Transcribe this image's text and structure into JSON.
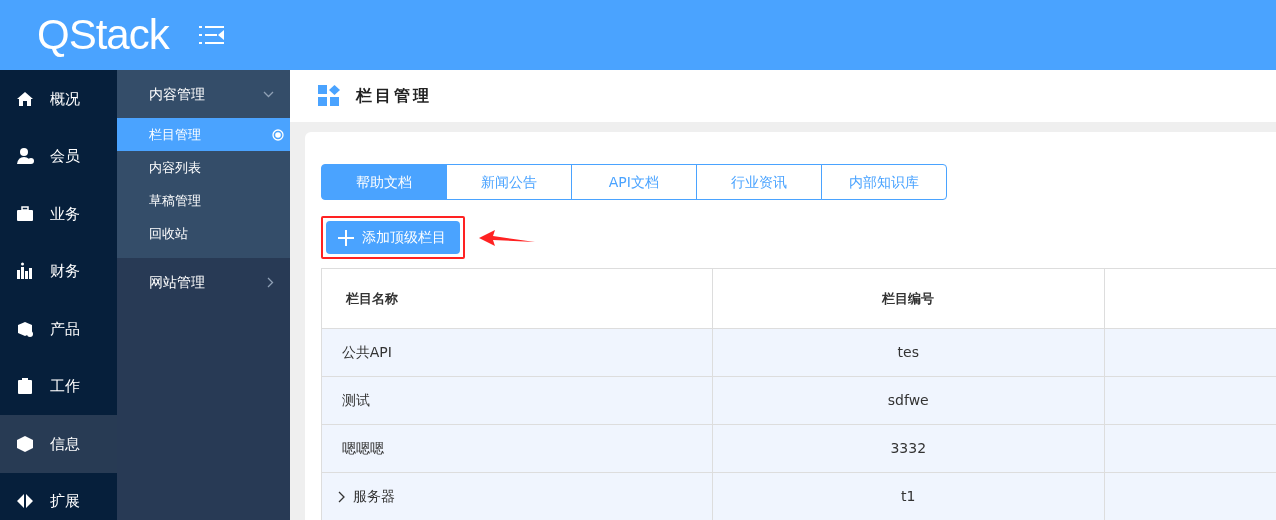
{
  "header": {
    "logo": "QStack"
  },
  "nav": [
    {
      "label": "概况",
      "selected": false
    },
    {
      "label": "会员",
      "selected": false
    },
    {
      "label": "业务",
      "selected": false
    },
    {
      "label": "财务",
      "selected": false
    },
    {
      "label": "产品",
      "selected": false
    },
    {
      "label": "工作",
      "selected": false
    },
    {
      "label": "信息",
      "selected": true
    },
    {
      "label": "扩展",
      "selected": false
    }
  ],
  "submenu": [
    {
      "label": "内容管理",
      "expanded": true,
      "children": [
        {
          "label": "栏目管理",
          "selected": true
        },
        {
          "label": "内容列表",
          "selected": false
        },
        {
          "label": "草稿管理",
          "selected": false
        },
        {
          "label": "回收站",
          "selected": false
        }
      ]
    },
    {
      "label": "网站管理",
      "expanded": false
    }
  ],
  "page_title": "栏目管理",
  "tabs": [
    {
      "label": "帮助文档",
      "selected": true
    },
    {
      "label": "新闻公告",
      "selected": false
    },
    {
      "label": "API文档",
      "selected": false
    },
    {
      "label": "行业资讯",
      "selected": false
    },
    {
      "label": "内部知识库",
      "selected": false
    }
  ],
  "add_button": "添加顶级栏目",
  "table": {
    "columns": [
      "栏目名称",
      "栏目编号"
    ],
    "rows": [
      {
        "name": "公共API",
        "code": "tes",
        "expandable": false
      },
      {
        "name": "测试",
        "code": "sdfwe",
        "expandable": false
      },
      {
        "name": "嗯嗯嗯",
        "code": "3332",
        "expandable": false
      },
      {
        "name": "服务器",
        "code": "t1",
        "expandable": true
      }
    ]
  }
}
